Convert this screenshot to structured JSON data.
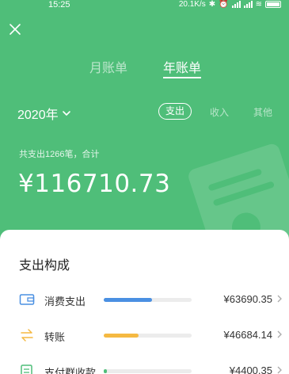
{
  "status": {
    "time": "15:25",
    "network_speed": "20.1K/s",
    "battery": "86"
  },
  "header": {
    "tabs": [
      {
        "label": "月账单",
        "active": false
      },
      {
        "label": "年账单",
        "active": true
      }
    ]
  },
  "filters": {
    "year": "2020年",
    "options": [
      {
        "label": "支出",
        "active": true
      },
      {
        "label": "收入",
        "active": false
      },
      {
        "label": "其他",
        "active": false
      }
    ]
  },
  "summary": {
    "text": "共支出1266笔，合计",
    "total": "¥116710.73"
  },
  "breakdown": {
    "title": "支出构成",
    "items": [
      {
        "label": "消费支出",
        "amount": "¥63690.35",
        "fraction": 0.55,
        "color": "#4a90e2",
        "icon": "wallet-icon"
      },
      {
        "label": "转账",
        "amount": "¥46684.14",
        "fraction": 0.4,
        "color": "#f5b942",
        "icon": "transfer-icon"
      },
      {
        "label": "支付群收款",
        "amount": "¥4400.35",
        "fraction": 0.04,
        "color": "#4fbe79",
        "icon": "group-pay-icon"
      }
    ]
  },
  "colors": {
    "brand_green": "#4fbe79"
  }
}
